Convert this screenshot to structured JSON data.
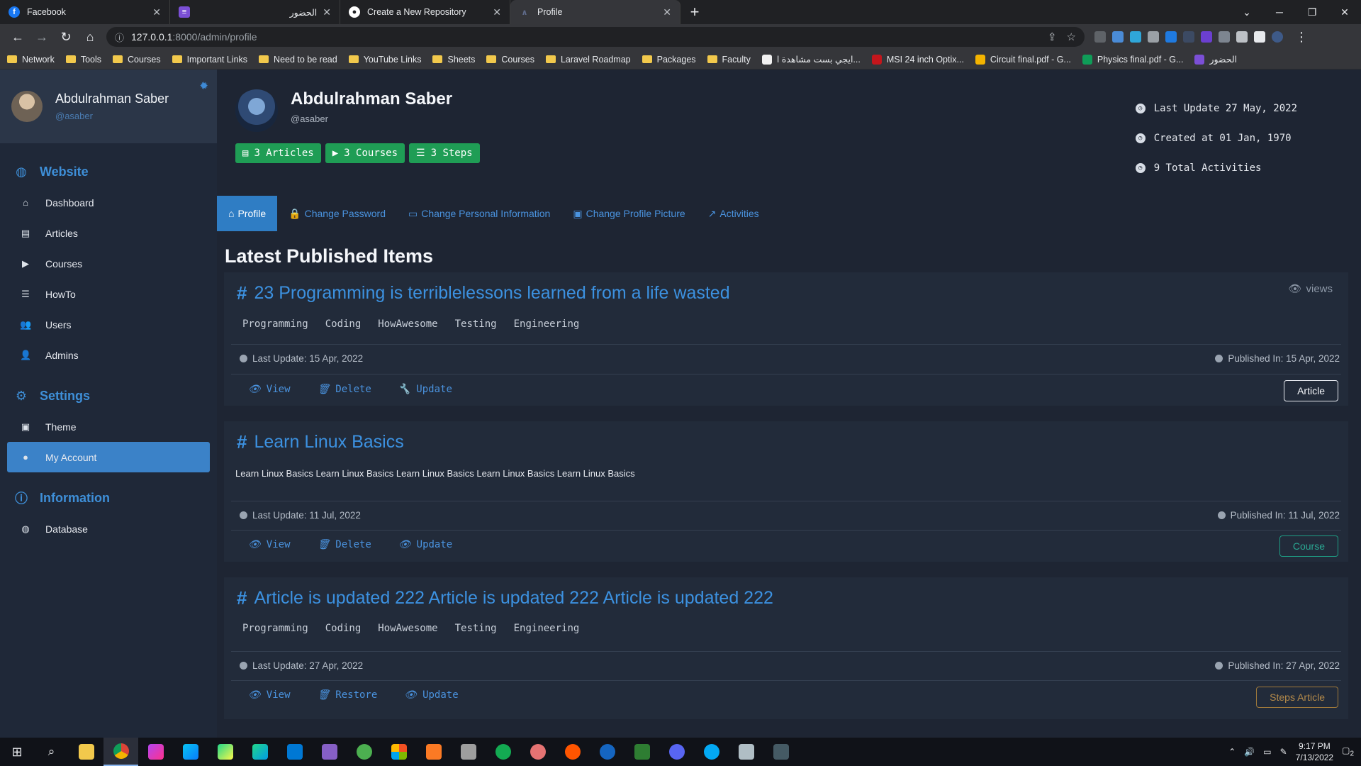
{
  "browser": {
    "tabs": [
      {
        "label": "Facebook",
        "color": "#1877f2",
        "glyph": "f"
      },
      {
        "label": "الحضور",
        "color": "#7b4fd6",
        "glyph": "≡"
      },
      {
        "label": "Create a New Repository",
        "color": "#ffffff",
        "glyph": "◉"
      },
      {
        "label": "Profile",
        "color": "#5f6b8a",
        "glyph": "/\\"
      }
    ],
    "url_host": "127.0.0.1",
    "url_path": ":8000/admin/profile",
    "bookmarks": [
      "Network",
      "Tools",
      "Courses",
      "Important Links",
      "Need to be read",
      "YouTube Links",
      "Sheets",
      "Courses",
      "Laravel Roadmap",
      "Packages",
      "Faculty",
      "ايجي بست مشاهدة ا...",
      "MSI 24 inch Optix...",
      "Circuit final.pdf - G...",
      "Physics final.pdf - G...",
      "الحضور"
    ]
  },
  "sidebar": {
    "user_name": "Abdulrahman Saber",
    "user_handle": "@asaber",
    "sections": {
      "website": "Website",
      "settings": "Settings",
      "information": "Information"
    },
    "items": {
      "dashboard": "Dashboard",
      "articles": "Articles",
      "courses": "Courses",
      "howto": "HowTo",
      "users": "Users",
      "admins": "Admins",
      "theme": "Theme",
      "my_account": "My Account",
      "database": "Database"
    }
  },
  "profile": {
    "name": "Abdulrahman Saber",
    "handle": "@asaber",
    "badges": {
      "articles": "3 Articles",
      "courses": "3 Courses",
      "steps": "3 Steps"
    },
    "last_update": "Last Update 27 May, 2022",
    "created_at": "Created at 01 Jan, 1970",
    "total_activities": "9 Total Activities"
  },
  "tabs": {
    "profile": "Profile",
    "change_password": "Change Password",
    "change_personal": "Change Personal Information",
    "change_picture": "Change Profile Picture",
    "activities": "Activities"
  },
  "section_title": "Latest Published Items",
  "items": [
    {
      "title": "23 Programming is terriblelessons learned from a life wasted",
      "views": "views",
      "tags": [
        "Programming",
        "Coding",
        "HowAwesome",
        "Testing",
        "Engineering"
      ],
      "last_update": "Last Update: 15 Apr, 2022",
      "published": "Published In: 15 Apr, 2022",
      "actions": [
        "View",
        "Delete",
        "Update"
      ],
      "type": "Article"
    },
    {
      "title": "Learn Linux Basics",
      "description": "Learn Linux Basics Learn Linux Basics Learn Linux Basics Learn Linux Basics Learn Linux Basics",
      "last_update": "Last Update: 11 Jul, 2022",
      "published": "Published In: 11 Jul, 2022",
      "actions": [
        "View",
        "Delete",
        "Update"
      ],
      "type": "Course"
    },
    {
      "title": "Article is updated 222 Article is updated 222 Article is updated 222",
      "tags": [
        "Programming",
        "Coding",
        "HowAwesome",
        "Testing",
        "Engineering"
      ],
      "last_update": "Last Update: 27 Apr, 2022",
      "published": "Published In: 27 Apr, 2022",
      "actions": [
        "View",
        "Restore",
        "Update"
      ],
      "type": "Steps Article"
    }
  ],
  "taskbar": {
    "time": "9:17 PM",
    "date": "7/13/2022",
    "notifications": "2"
  }
}
